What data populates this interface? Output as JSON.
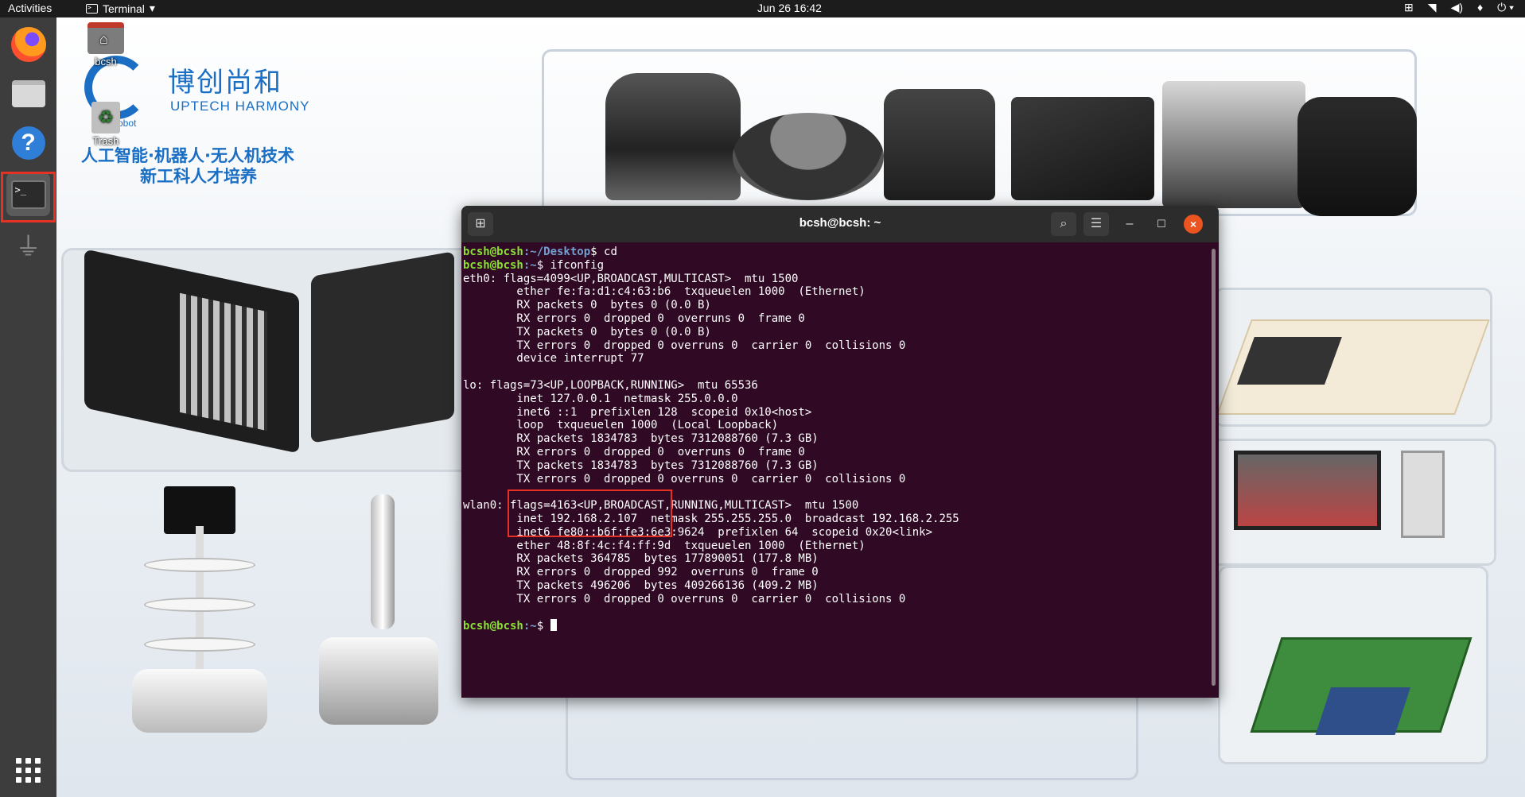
{
  "topbar": {
    "activities": "Activities",
    "app_name": "Terminal",
    "clock": "Jun 26  16:42",
    "tray": {
      "network_icon": "network-tree-icon",
      "wifi_icon": "wifi-icon",
      "volume_icon": "volume-icon",
      "mic_icon": "mic-icon",
      "power_icon": "power-icon"
    }
  },
  "dock": {
    "items": [
      {
        "name": "Firefox",
        "icon": "firefox-icon"
      },
      {
        "name": "Files",
        "icon": "files-icon"
      },
      {
        "name": "Help",
        "icon": "help-icon",
        "glyph": "?"
      },
      {
        "name": "Terminal",
        "icon": "terminal-icon",
        "glyph": ">_",
        "active": true
      },
      {
        "name": "USB",
        "icon": "usb-icon"
      },
      {
        "name": "Show Applications",
        "icon": "app-grid-icon"
      }
    ]
  },
  "desktop": {
    "home_icon_label": "bcsh",
    "trash_icon_label": "Trash",
    "logo_cn": "博创尚和",
    "logo_en": "UPTECH HARMONY",
    "logo_robot": "robot",
    "tagline_1": "人工智能·机器人·无人机技术",
    "tagline_2": "新工科人才培养"
  },
  "terminal": {
    "title": "bcsh@bcsh: ~",
    "prompt_user": "bcsh@bcsh",
    "lines": [
      {
        "path": ":~/Desktop",
        "cmd": "$ cd"
      },
      {
        "path": ":~",
        "cmd": "$ ifconfig"
      }
    ],
    "output": [
      "eth0: flags=4099<UP,BROADCAST,MULTICAST>  mtu 1500",
      "        ether fe:fa:d1:c4:63:b6  txqueuelen 1000  (Ethernet)",
      "        RX packets 0  bytes 0 (0.0 B)",
      "        RX errors 0  dropped 0  overruns 0  frame 0",
      "        TX packets 0  bytes 0 (0.0 B)",
      "        TX errors 0  dropped 0 overruns 0  carrier 0  collisions 0",
      "        device interrupt 77",
      "",
      "lo: flags=73<UP,LOOPBACK,RUNNING>  mtu 65536",
      "        inet 127.0.0.1  netmask 255.0.0.0",
      "        inet6 ::1  prefixlen 128  scopeid 0x10<host>",
      "        loop  txqueuelen 1000  (Local Loopback)",
      "        RX packets 1834783  bytes 7312088760 (7.3 GB)",
      "        RX errors 0  dropped 0  overruns 0  frame 0",
      "        TX packets 1834783  bytes 7312088760 (7.3 GB)",
      "        TX errors 0  dropped 0 overruns 0  carrier 0  collisions 0",
      "",
      "wlan0: flags=4163<UP,BROADCAST,RUNNING,MULTICAST>  mtu 1500",
      "        inet 192.168.2.107  netmask 255.255.255.0  broadcast 192.168.2.255",
      "        inet6 fe80::b6f:fe3:6e3:9624  prefixlen 64  scopeid 0x20<link>",
      "        ether 48:8f:4c:f4:ff:9d  txqueuelen 1000  (Ethernet)",
      "        RX packets 364785  bytes 177890051 (177.8 MB)",
      "        RX errors 0  dropped 992  overruns 0  frame 0",
      "        TX packets 496206  bytes 409266136 (409.2 MB)",
      "        TX errors 0  dropped 0 overruns 0  carrier 0  collisions 0",
      ""
    ],
    "final_prompt_path": ":~",
    "final_prompt_symbol": "$ "
  },
  "colors": {
    "terminal_bg": "#300a24",
    "prompt_user": "#8ae234",
    "prompt_path": "#729fcf",
    "highlight": "#e53224",
    "ubuntu_orange": "#e95420"
  }
}
